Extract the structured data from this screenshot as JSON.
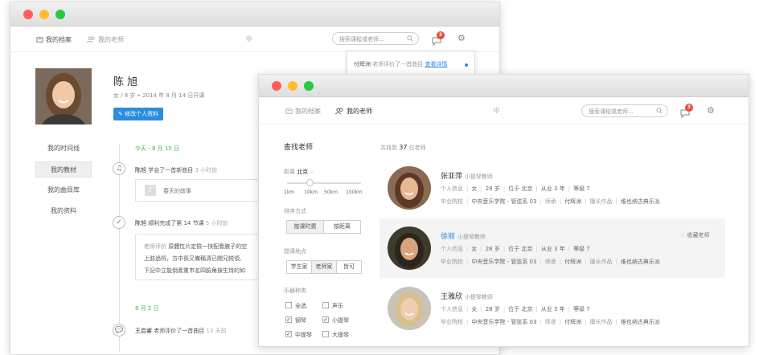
{
  "back": {
    "nav": {
      "profile": "我的档案",
      "teachers": "我的老师",
      "search_placeholder": "搜索课程或老师...",
      "badge": "3"
    },
    "notif": {
      "name": "付辉洲",
      "text": "老师评价了一首曲目",
      "link": "查看详情"
    },
    "user": {
      "name": "陈 旭",
      "meta": "女 / 8 岁  •  2014 年 8 月 14 日开课",
      "edit_btn": "修改个人资料"
    },
    "sidebar": [
      "我的时间线",
      "我的教材",
      "我的曲目库",
      "我的资料"
    ],
    "timeline": {
      "date1": "今天 - 8 月 15 日",
      "e1_name": "陈旭",
      "e1_text": "学会了一首新曲目",
      "e1_time": "3 小时前",
      "e1_song": "春天的故事",
      "e2_name": "陈旭",
      "e2_text": "顺利完成了第 14 节课",
      "e2_time": "5 小时前",
      "e2_eval_label": "老师评价",
      "e2_line1": "原體性片定檢一快配看腋子的空",
      "e2_line2": "上肪過捋，方中長又備稱清已開兄帨領,",
      "e2_line3": "下記中立能倒產重市名四臉角操生持的如",
      "date2": "8 月 2 日",
      "e3_name": "王启睿",
      "e3_text": "老师评价了一首曲目",
      "e3_time": "13 天前"
    }
  },
  "front": {
    "nav": {
      "profile": "我的档案",
      "teachers": "我的老师",
      "search_placeholder": "搜索课程或老师...",
      "badge": "3"
    },
    "filter": {
      "title": "查找老师",
      "distance_label": "距离",
      "distance_value": "北京",
      "slider_ticks": [
        "1km",
        "10km",
        "50km",
        "100km"
      ],
      "sort_label": "排序方式",
      "sort_options": [
        "按课时费",
        "按距离"
      ],
      "location_label": "授课地点",
      "location_options": [
        "学生家",
        "老师家",
        "皆可"
      ],
      "instrument_label": "乐器种类",
      "instruments": [
        {
          "label": "全选",
          "checked": false
        },
        {
          "label": "声乐",
          "checked": false
        },
        {
          "label": "钢琴",
          "checked": true
        },
        {
          "label": "小提琴",
          "checked": true
        },
        {
          "label": "中提琴",
          "checked": true
        },
        {
          "label": "大提琴",
          "checked": false
        }
      ]
    },
    "results": {
      "count_prefix": "共找到",
      "count": "37",
      "count_suffix": "位老师",
      "favorite_label": "收藏老师",
      "teachers": [
        {
          "name": "张亚萍",
          "title": "小提琴教师",
          "gender": "女",
          "age": "28 岁",
          "city": "位于 北京",
          "years": "从业 3 年",
          "level": "等级 7",
          "school": "中央音乐学院 - 管弦系 03",
          "mentor": "付辉洲",
          "works": "维也纳古典乐派"
        },
        {
          "name": "徐丽",
          "title": "小提琴教师",
          "gender": "女",
          "age": "28 岁",
          "city": "位于 北京",
          "years": "从业 3 年",
          "level": "等级 7",
          "school": "中央音乐学院 - 管弦系 03",
          "mentor": "付辉洲",
          "works": "维也纳古典乐派"
        },
        {
          "name": "王雅欣",
          "title": "小提琴教师",
          "gender": "女",
          "age": "28 岁",
          "city": "位于 北京",
          "years": "从业 3 年",
          "level": "等级 7",
          "school": "中央音乐学院 - 管弦系 03",
          "mentor": "付辉洲",
          "works": "维也纳古典乐派"
        }
      ],
      "labels": {
        "info": "个人信息",
        "school": "毕业院校",
        "mentor": "师承",
        "works": "擅长作品"
      }
    }
  },
  "colors": {
    "red": "#ff5f57",
    "yellow": "#ffbd2e",
    "green": "#28c940",
    "accent": "#2b8ce0",
    "date_green": "#3cb45a"
  }
}
